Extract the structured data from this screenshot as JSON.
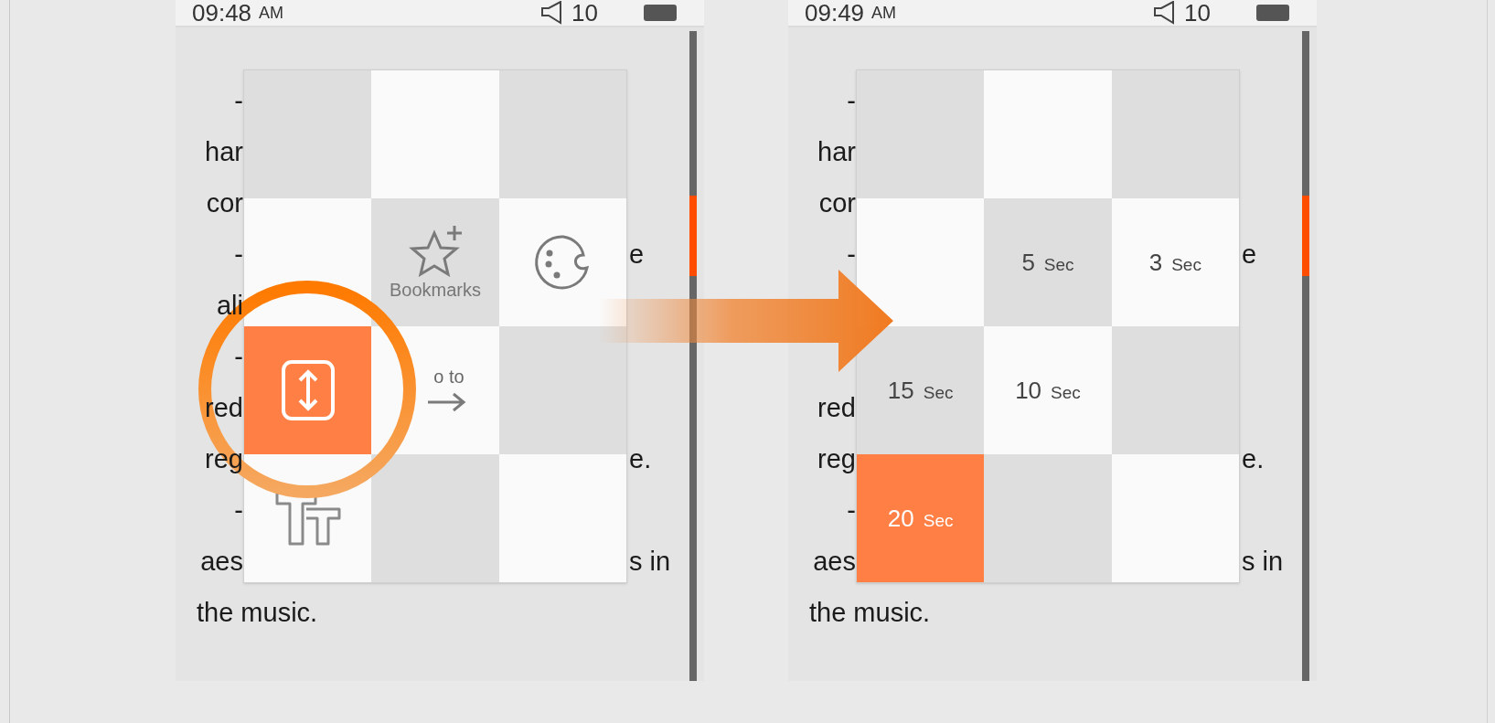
{
  "screens": [
    {
      "status": {
        "time": "09:48",
        "meridiem": "AM",
        "volume": "10"
      },
      "lines": [
        {
          "kind": "split",
          "left": "-"
        },
        {
          "kind": "split",
          "left": "har"
        },
        {
          "kind": "split",
          "left": "cor"
        },
        {
          "kind": "split",
          "left": "-",
          "right": "e"
        },
        {
          "kind": "split",
          "left": "ali"
        },
        {
          "kind": "split",
          "left": "-"
        },
        {
          "kind": "split",
          "left": "red"
        },
        {
          "kind": "split",
          "left": "reg",
          "right": "e."
        },
        {
          "kind": "split",
          "left": "-"
        },
        {
          "kind": "split",
          "left": "aes",
          "right": "s in"
        },
        {
          "kind": "full",
          "left": "the music."
        }
      ],
      "menu": [
        {
          "kind": "empty",
          "selected": false
        },
        {
          "kind": "empty",
          "selected": false
        },
        {
          "kind": "empty",
          "selected": false
        },
        {
          "kind": "empty",
          "selected": false
        },
        {
          "kind": "bookmarks",
          "label": "Bookmarks",
          "selected": false
        },
        {
          "kind": "theme",
          "selected": false
        },
        {
          "kind": "autoscroll",
          "selected": true
        },
        {
          "kind": "goto",
          "label": "o to",
          "selected": false
        },
        {
          "kind": "empty",
          "selected": false
        },
        {
          "kind": "fontsize",
          "selected": false
        },
        {
          "kind": "empty",
          "selected": false
        },
        {
          "kind": "empty",
          "selected": false
        }
      ]
    },
    {
      "status": {
        "time": "09:49",
        "meridiem": "AM",
        "volume": "10"
      },
      "lines": [
        {
          "kind": "split",
          "left": "-"
        },
        {
          "kind": "split",
          "left": "har"
        },
        {
          "kind": "split",
          "left": "cor"
        },
        {
          "kind": "split",
          "left": "-",
          "right": "e"
        },
        {
          "kind": "blank"
        },
        {
          "kind": "blank"
        },
        {
          "kind": "split",
          "left": "red"
        },
        {
          "kind": "split",
          "left": "reg",
          "right": "e."
        },
        {
          "kind": "split",
          "left": "-"
        },
        {
          "kind": "split",
          "left": "aes",
          "right": "s in"
        },
        {
          "kind": "full",
          "left": "the music."
        }
      ],
      "menu": [
        {
          "kind": "empty",
          "selected": false
        },
        {
          "kind": "empty",
          "selected": false
        },
        {
          "kind": "empty",
          "selected": false
        },
        {
          "kind": "empty",
          "selected": false
        },
        {
          "kind": "duration",
          "value": "5",
          "unit": "Sec",
          "selected": false
        },
        {
          "kind": "duration",
          "value": "3",
          "unit": "Sec",
          "selected": false
        },
        {
          "kind": "duration",
          "value": "15",
          "unit": "Sec",
          "selected": false
        },
        {
          "kind": "duration",
          "value": "10",
          "unit": "Sec",
          "selected": false
        },
        {
          "kind": "empty",
          "selected": false
        },
        {
          "kind": "duration",
          "value": "20",
          "unit": "Sec",
          "selected": true
        },
        {
          "kind": "empty",
          "selected": false
        },
        {
          "kind": "empty",
          "selected": false
        }
      ]
    }
  ]
}
